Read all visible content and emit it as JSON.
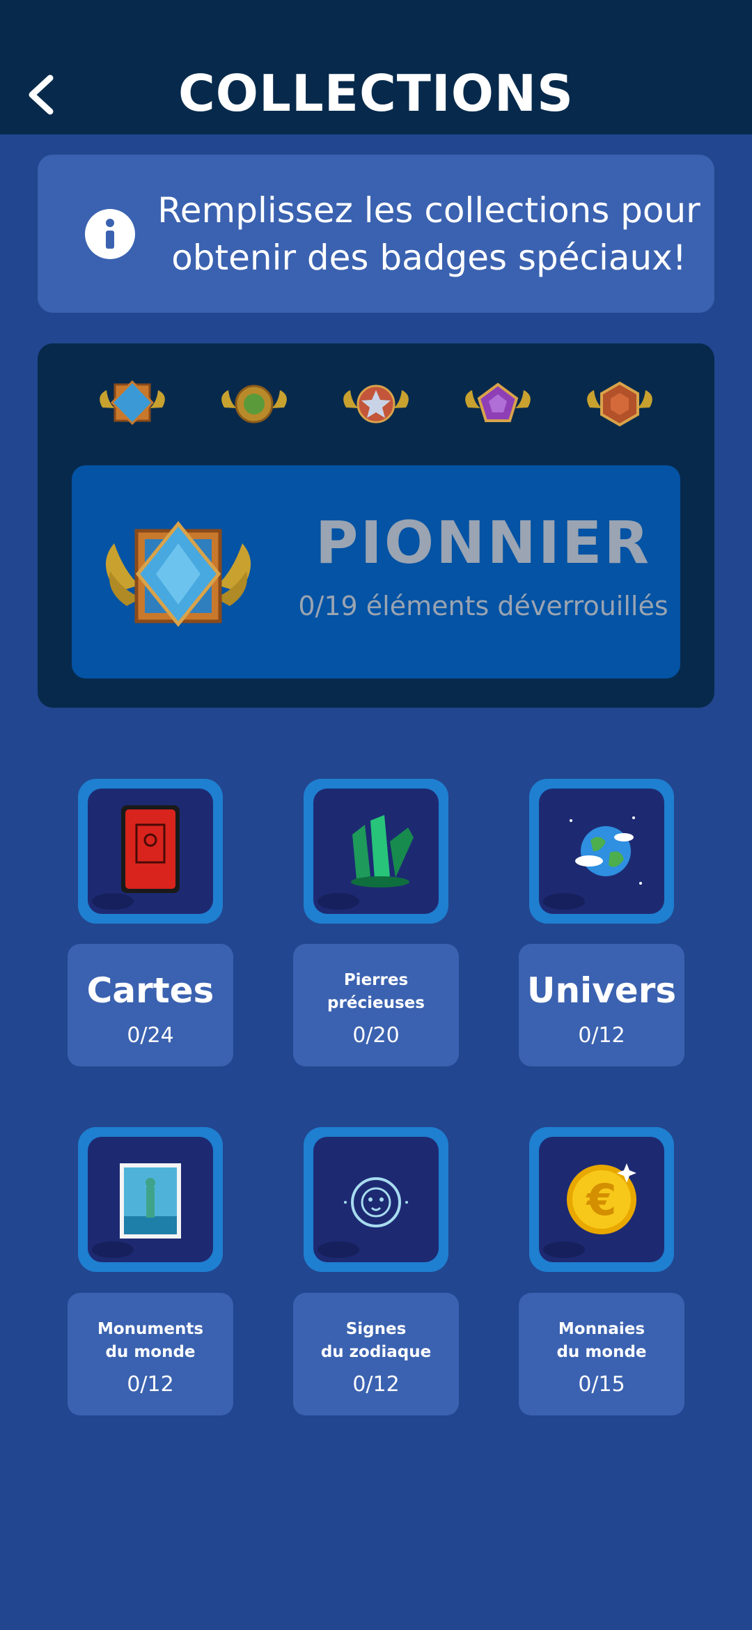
{
  "header": {
    "title": "COLLECTIONS",
    "back_icon": "chevron-left-icon"
  },
  "info": {
    "icon": "info-icon",
    "text": "Remplissez les collections pour obtenir des badges spéciaux!"
  },
  "badges": {
    "mini": [
      "blue-diamond-badge",
      "green-gear-badge",
      "silver-star-badge",
      "purple-pentagon-badge",
      "copper-hexagon-badge"
    ],
    "current": {
      "name": "PIONNIER",
      "progress_text": "0/19 éléments déverrouillés"
    }
  },
  "collections": [
    {
      "name": "Cartes",
      "count": "0/24",
      "icon": "red-card-icon",
      "style": "big"
    },
    {
      "name": "Pierres\nprécieuses",
      "count": "0/20",
      "icon": "emerald-gem-icon",
      "style": "small"
    },
    {
      "name": "Univers",
      "count": "0/12",
      "icon": "earth-globe-icon",
      "style": "big"
    },
    {
      "name": "Monuments\ndu monde",
      "count": "0/12",
      "icon": "statue-stamp-icon",
      "style": "small"
    },
    {
      "name": "Signes\ndu zodiaque",
      "count": "0/12",
      "icon": "lion-zodiac-icon",
      "style": "small"
    },
    {
      "name": "Monnaies\ndu monde",
      "count": "0/15",
      "icon": "euro-coin-icon",
      "style": "small"
    }
  ],
  "colors": {
    "background": "#22468f",
    "header": "#072a4c",
    "card": "#3b62b0",
    "pioneer_card": "#0453a4",
    "muted_text": "#9aa4b2"
  }
}
